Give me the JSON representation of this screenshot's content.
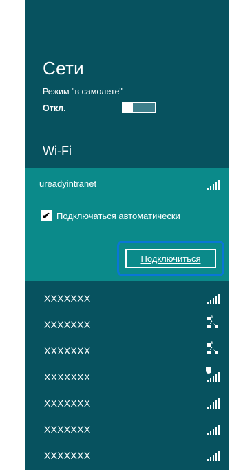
{
  "panel": {
    "title": "Сети",
    "airplane_mode": {
      "label": "Режим \"в самолете\"",
      "state": "Откл."
    },
    "wifi_heading": "Wi-Fi",
    "selected_network": {
      "name": "ureadyintranet",
      "auto_connect_label": "Подключаться автоматически",
      "auto_connect_checked": true,
      "connect_button": "Подключиться"
    },
    "networks": [
      {
        "name": "XXXXXXX",
        "icon": "signal-icon"
      },
      {
        "name": "XXXXXXX",
        "icon": "ad-hoc-network-icon"
      },
      {
        "name": "XXXXXXX",
        "icon": "ad-hoc-network-icon"
      },
      {
        "name": "XXXXXXX",
        "icon": "secured-signal-icon"
      },
      {
        "name": "XXXXXXX",
        "icon": "signal-icon"
      },
      {
        "name": "XXXXXXX",
        "icon": "signal-icon"
      },
      {
        "name": "XXXXXXX",
        "icon": "signal-icon"
      }
    ]
  },
  "colors": {
    "panel_bg": "#07525f",
    "selected_bg": "#0b8a8a",
    "highlight": "#0a76d6"
  }
}
